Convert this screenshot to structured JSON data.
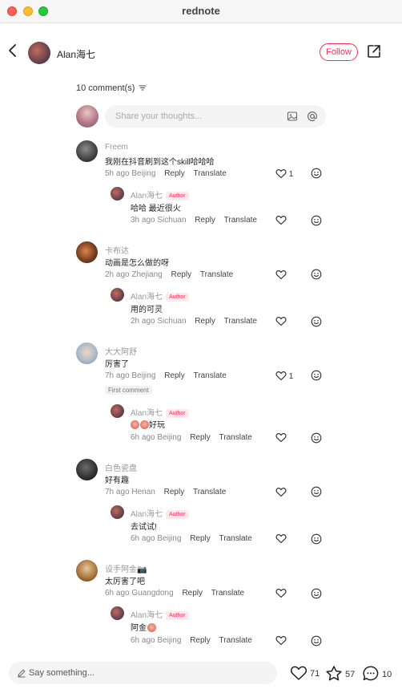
{
  "window": {
    "title": "rednote"
  },
  "post": {
    "author_name": "Alan海七",
    "follow_label": "Follow"
  },
  "comments_section": {
    "count_label": "10 comment(s)",
    "input_placeholder": "Share your thoughts..."
  },
  "comments": [
    {
      "name": "Freem",
      "text": "我刚在抖音刷到这个skill哈哈哈",
      "time": "5h ago",
      "location": "Beijing",
      "likes": "1",
      "reply": {
        "name": "Alan海七",
        "badge": "Author",
        "text": "哈哈 最近很火",
        "time": "3h ago",
        "location": "Sichuan"
      }
    },
    {
      "name": "卡布达",
      "text": "动画是怎么做的呀",
      "time": "2h ago",
      "location": "Zhejiang",
      "likes": "",
      "reply": {
        "name": "Alan海七",
        "badge": "Author",
        "text": "用的可灵",
        "time": "2h ago",
        "location": "Sichuan"
      }
    },
    {
      "name": "大大阿舒",
      "text": "厉害了",
      "time": "7h ago",
      "location": "Beijing",
      "likes": "1",
      "tag": "First comment",
      "reply": {
        "name": "Alan海七",
        "badge": "Author",
        "text": "好玩",
        "time": "6h ago",
        "location": "Beijing"
      }
    },
    {
      "name": "白色瓷盘",
      "text": "好有趣",
      "time": "7h ago",
      "location": "Henan",
      "likes": "",
      "reply": {
        "name": "Alan海七",
        "badge": "Author",
        "text": "去试试!",
        "time": "6h ago",
        "location": "Beijing"
      }
    },
    {
      "name": "设手阿金📷",
      "text": "太厉害了吧",
      "time": "6h ago",
      "location": "Guangdong",
      "likes": "",
      "reply": {
        "name": "Alan海七",
        "badge": "Author",
        "text": "阿金",
        "time": "6h ago",
        "location": "Beijing"
      }
    }
  ],
  "actions": {
    "reply_label": "Reply",
    "translate_label": "Translate"
  },
  "bottom_bar": {
    "placeholder": "Say something...",
    "likes": "71",
    "favorites": "57",
    "comments": "10"
  },
  "colors": {
    "accent": "#ff2d55"
  },
  "icons": [
    "back-icon",
    "share-icon",
    "filter-icon",
    "image-icon",
    "at-icon",
    "heart-icon",
    "emoji-icon",
    "pencil-icon",
    "star-icon",
    "comment-bubble-icon"
  ]
}
